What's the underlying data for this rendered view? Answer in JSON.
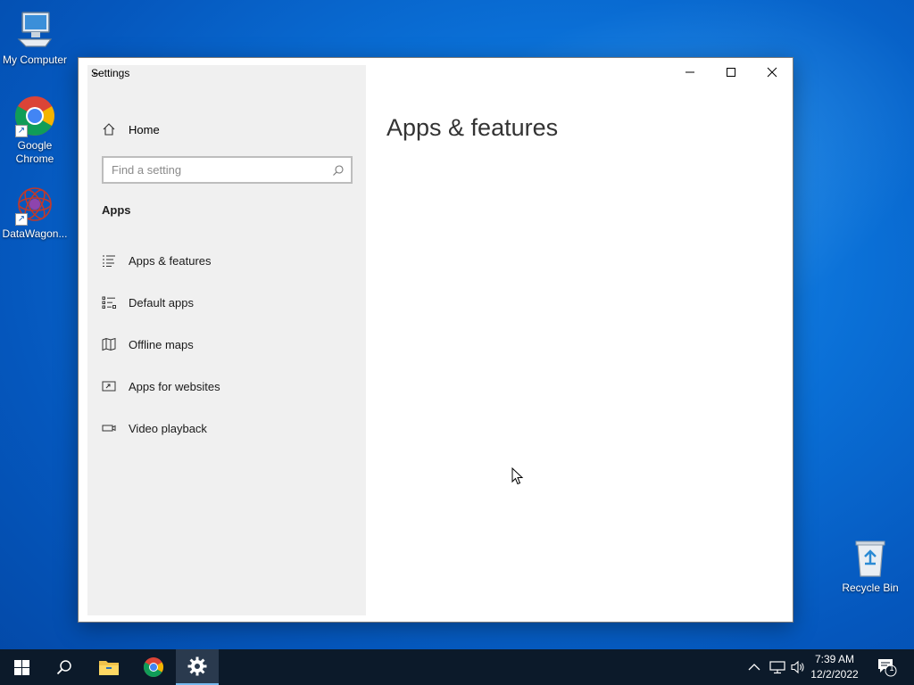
{
  "desktop": {
    "icons": [
      {
        "label": "My Computer"
      },
      {
        "label": "Google Chrome"
      },
      {
        "label": "DataWagon..."
      },
      {
        "label": "Recycle Bin"
      }
    ]
  },
  "window": {
    "title": "Settings",
    "back_icon": "back-arrow-icon",
    "controls": [
      "minimize",
      "maximize",
      "close"
    ]
  },
  "sidebar": {
    "home_label": "Home",
    "search_placeholder": "Find a setting",
    "section_title": "Apps",
    "items": [
      {
        "label": "Apps & features",
        "icon": "list-icon"
      },
      {
        "label": "Default apps",
        "icon": "default-apps-icon"
      },
      {
        "label": "Offline maps",
        "icon": "map-icon"
      },
      {
        "label": "Apps for websites",
        "icon": "website-app-icon"
      },
      {
        "label": "Video playback",
        "icon": "video-icon"
      }
    ]
  },
  "main": {
    "page_title": "Apps & features"
  },
  "taskbar": {
    "time": "7:39 AM",
    "date": "12/2/2022",
    "notification_count": "1",
    "accent_color": "#76b9ed"
  }
}
